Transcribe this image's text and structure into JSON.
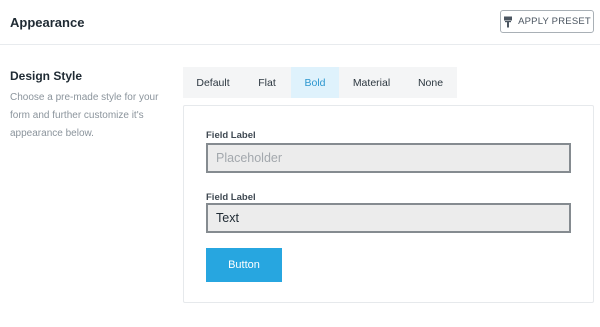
{
  "header": {
    "title": "Appearance",
    "apply_preset_label": "APPLY PRESET",
    "apply_preset_icon": "paint-roller-icon"
  },
  "design_style": {
    "title": "Design Style",
    "description": "Choose a pre-made style for your form and further customize it's appearance below."
  },
  "tabs": [
    {
      "label": "Default",
      "active": false
    },
    {
      "label": "Flat",
      "active": false
    },
    {
      "label": "Bold",
      "active": true
    },
    {
      "label": "Material",
      "active": false
    },
    {
      "label": "None",
      "active": false
    }
  ],
  "preview": {
    "field1_label": "Field Label",
    "field1_placeholder": "Placeholder",
    "field2_label": "Field Label",
    "field2_value": "Text",
    "button_label": "Button"
  },
  "colors": {
    "accent": "#27a6e0",
    "active_tab_bg": "#dff2fc",
    "active_tab_text": "#2d97cf"
  }
}
